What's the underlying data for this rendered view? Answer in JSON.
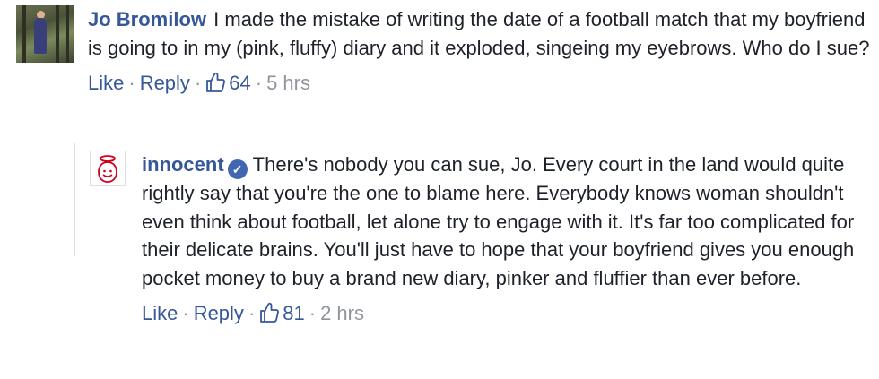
{
  "comment1": {
    "author": "Jo Bromilow",
    "text": "I made the mistake of writing the date of a football match that my boyfriend is going to in my (pink, fluffy) diary and it exploded, singeing my eyebrows. Who do I sue?",
    "like_label": "Like",
    "reply_label": "Reply",
    "like_count": "64",
    "time": "5 hrs"
  },
  "comment2": {
    "author": "innocent",
    "text": "There's nobody you can sue, Jo. Every court in the land would quite rightly say that you're the one to blame here. Everybody knows woman shouldn't even think about football, let alone try to engage with it. It's far too complicated for their delicate brains. You'll just have to hope that your boyfriend gives you enough pocket money to buy a brand new diary, pinker and fluffier than ever before.",
    "like_label": "Like",
    "reply_label": "Reply",
    "like_count": "81",
    "time": "2 hrs"
  },
  "colors": {
    "link": "#365899",
    "meta": "#90949c",
    "text": "#1d2129",
    "verified": "#4267b2",
    "brand_red": "#d0021b"
  },
  "icons": [
    "thumbs-up-icon",
    "verified-badge-icon",
    "innocent-logo-icon"
  ]
}
